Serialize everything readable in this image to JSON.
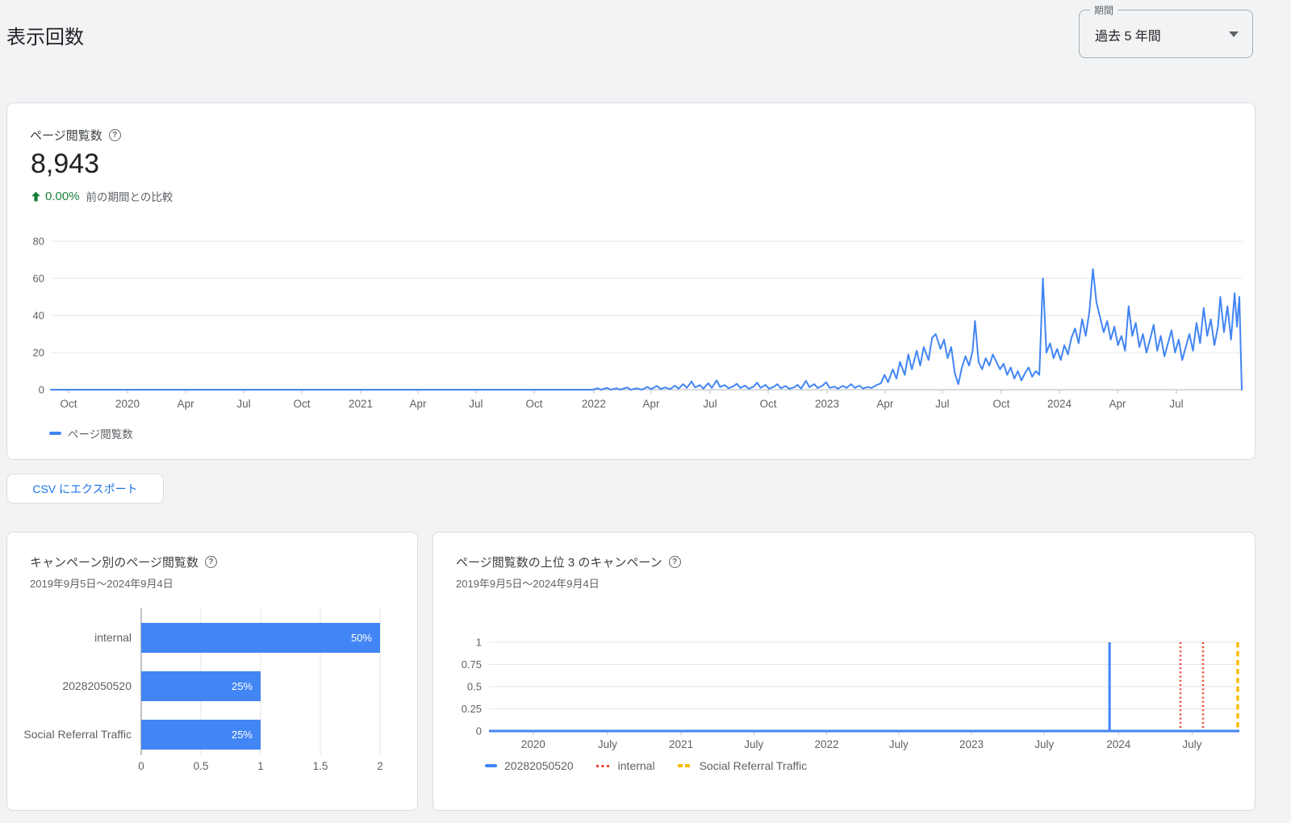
{
  "page": {
    "title": "表示回数"
  },
  "period_select": {
    "label": "期間",
    "value": "過去 5 年間"
  },
  "pageviews_card": {
    "title": "ページ閲覧数",
    "total": "8,943",
    "delta_percent": "0.00%",
    "delta_caption": "前の期間との比較",
    "legend_label": "ページ閲覧数"
  },
  "export_button": {
    "label": "CSV にエクスポート"
  },
  "campaign_bar_card": {
    "title": "キャンペーン別のページ閲覧数",
    "subtitle": "2019年9月5日〜2024年9月4日"
  },
  "top_campaigns_card": {
    "title": "ページ閲覧数の上位 3 のキャンペーン",
    "subtitle": "2019年9月5日〜2024年9月4日",
    "legend": [
      {
        "label": "20282050520",
        "color": "#4285f4",
        "style": "solid"
      },
      {
        "label": "internal",
        "color": "#ea4335",
        "style": "dotted"
      },
      {
        "label": "Social Referral Traffic",
        "color": "#fbbc04",
        "style": "dashed"
      }
    ]
  },
  "colors": {
    "accent_blue": "#4285f4",
    "link_blue": "#1a73e8",
    "positive_green": "#188038",
    "event_red": "#ea4335",
    "event_yellow": "#fbbc04",
    "grid": "#e6e6e6",
    "axis_text": "#616161",
    "background": "#f1f3f4"
  },
  "chart_data": [
    {
      "type": "line",
      "title": "ページ閲覧数",
      "ylim": [
        0,
        80
      ],
      "yticks": [
        0,
        20,
        40,
        60,
        80
      ],
      "ytick_labels": [
        "0",
        "20",
        "40",
        "60",
        "80"
      ],
      "xticks": {
        "labels": [
          "Oct",
          "2020",
          "Apr",
          "Jul",
          "Oct",
          "2021",
          "Apr",
          "Jul",
          "Oct",
          "2022",
          "Apr",
          "Jul",
          "Oct",
          "2023",
          "Apr",
          "Jul",
          "Oct",
          "2024",
          "Apr",
          "Jul"
        ],
        "fracs": [
          0.0149,
          0.0644,
          0.1132,
          0.1619,
          0.2107,
          0.2602,
          0.3083,
          0.357,
          0.4058,
          0.4559,
          0.5041,
          0.5535,
          0.6023,
          0.6518,
          0.7005,
          0.7486,
          0.798,
          0.8469,
          0.8957,
          0.9451
        ]
      },
      "series": [
        {
          "name": "ページ閲覧数",
          "color": "#4285f4",
          "points": [
            [
              0.0,
              0
            ],
            [
              0.05,
              0
            ],
            [
              0.1,
              0
            ],
            [
              0.15,
              0
            ],
            [
              0.2,
              0
            ],
            [
              0.25,
              0
            ],
            [
              0.3,
              0
            ],
            [
              0.35,
              0
            ],
            [
              0.4,
              0
            ],
            [
              0.44,
              0
            ],
            [
              0.455,
              0
            ],
            [
              0.459,
              0.8
            ],
            [
              0.462,
              0
            ],
            [
              0.467,
              1
            ],
            [
              0.47,
              0
            ],
            [
              0.475,
              0.8
            ],
            [
              0.478,
              0
            ],
            [
              0.484,
              1.2
            ],
            [
              0.487,
              0
            ],
            [
              0.492,
              0.8
            ],
            [
              0.496,
              0
            ],
            [
              0.501,
              1.5
            ],
            [
              0.504,
              0.3
            ],
            [
              0.509,
              2
            ],
            [
              0.512,
              0.4
            ],
            [
              0.516,
              1.2
            ],
            [
              0.52,
              0.3
            ],
            [
              0.524,
              2.2
            ],
            [
              0.527,
              0.6
            ],
            [
              0.531,
              3
            ],
            [
              0.534,
              1
            ],
            [
              0.538,
              4.5
            ],
            [
              0.541,
              1.2
            ],
            [
              0.545,
              2.5
            ],
            [
              0.548,
              0.6
            ],
            [
              0.552,
              3.5
            ],
            [
              0.555,
              1
            ],
            [
              0.559,
              5
            ],
            [
              0.562,
              1.5
            ],
            [
              0.566,
              2.5
            ],
            [
              0.569,
              0.8
            ],
            [
              0.573,
              1.8
            ],
            [
              0.576,
              3.2
            ],
            [
              0.579,
              0.9
            ],
            [
              0.583,
              2.2
            ],
            [
              0.586,
              0.5
            ],
            [
              0.59,
              1.6
            ],
            [
              0.593,
              3.8
            ],
            [
              0.596,
              1
            ],
            [
              0.6,
              2.6
            ],
            [
              0.603,
              0.6
            ],
            [
              0.607,
              1.5
            ],
            [
              0.61,
              3
            ],
            [
              0.613,
              0.8
            ],
            [
              0.617,
              2
            ],
            [
              0.62,
              0.5
            ],
            [
              0.624,
              1.2
            ],
            [
              0.627,
              2.6
            ],
            [
              0.63,
              0.6
            ],
            [
              0.634,
              4.8
            ],
            [
              0.637,
              1.4
            ],
            [
              0.641,
              3
            ],
            [
              0.644,
              0.9
            ],
            [
              0.648,
              2.2
            ],
            [
              0.651,
              4
            ],
            [
              0.654,
              1
            ],
            [
              0.658,
              1.6
            ],
            [
              0.661,
              0.5
            ],
            [
              0.665,
              2.1
            ],
            [
              0.668,
              0.9
            ],
            [
              0.672,
              3
            ],
            [
              0.675,
              1
            ],
            [
              0.679,
              2.2
            ],
            [
              0.682,
              0.6
            ],
            [
              0.686,
              1.5
            ],
            [
              0.689,
              0.9
            ],
            [
              0.693,
              2.4
            ],
            [
              0.697,
              3.5
            ],
            [
              0.7,
              8
            ],
            [
              0.703,
              4
            ],
            [
              0.707,
              11
            ],
            [
              0.71,
              6
            ],
            [
              0.713,
              15
            ],
            [
              0.717,
              8
            ],
            [
              0.72,
              19
            ],
            [
              0.723,
              11
            ],
            [
              0.727,
              21
            ],
            [
              0.73,
              13
            ],
            [
              0.733,
              23
            ],
            [
              0.737,
              16
            ],
            [
              0.74,
              28
            ],
            [
              0.743,
              30
            ],
            [
              0.747,
              22
            ],
            [
              0.75,
              27
            ],
            [
              0.753,
              17
            ],
            [
              0.756,
              23
            ],
            [
              0.759,
              9
            ],
            [
              0.762,
              3
            ],
            [
              0.765,
              12
            ],
            [
              0.768,
              18
            ],
            [
              0.771,
              13
            ],
            [
              0.774,
              21
            ],
            [
              0.776,
              37
            ],
            [
              0.779,
              15
            ],
            [
              0.782,
              11
            ],
            [
              0.785,
              17
            ],
            [
              0.788,
              13
            ],
            [
              0.791,
              19
            ],
            [
              0.794,
              15
            ],
            [
              0.797,
              11
            ],
            [
              0.8,
              14
            ],
            [
              0.803,
              8
            ],
            [
              0.806,
              12
            ],
            [
              0.809,
              6
            ],
            [
              0.812,
              10
            ],
            [
              0.815,
              5
            ],
            [
              0.818,
              9
            ],
            [
              0.821,
              12
            ],
            [
              0.824,
              7
            ],
            [
              0.827,
              10
            ],
            [
              0.83,
              8
            ],
            [
              0.833,
              60
            ],
            [
              0.836,
              20
            ],
            [
              0.839,
              25
            ],
            [
              0.842,
              17
            ],
            [
              0.845,
              22
            ],
            [
              0.848,
              16
            ],
            [
              0.851,
              24
            ],
            [
              0.854,
              19
            ],
            [
              0.857,
              28
            ],
            [
              0.86,
              33
            ],
            [
              0.863,
              25
            ],
            [
              0.866,
              38
            ],
            [
              0.869,
              29
            ],
            [
              0.872,
              42
            ],
            [
              0.875,
              65
            ],
            [
              0.878,
              47
            ],
            [
              0.881,
              39
            ],
            [
              0.884,
              31
            ],
            [
              0.887,
              37
            ],
            [
              0.89,
              27
            ],
            [
              0.893,
              34
            ],
            [
              0.896,
              24
            ],
            [
              0.899,
              29
            ],
            [
              0.902,
              21
            ],
            [
              0.905,
              45
            ],
            [
              0.908,
              29
            ],
            [
              0.911,
              36
            ],
            [
              0.914,
              23
            ],
            [
              0.917,
              30
            ],
            [
              0.92,
              20
            ],
            [
              0.923,
              27
            ],
            [
              0.926,
              35
            ],
            [
              0.929,
              21
            ],
            [
              0.932,
              29
            ],
            [
              0.935,
              18
            ],
            [
              0.938,
              25
            ],
            [
              0.941,
              32
            ],
            [
              0.944,
              20
            ],
            [
              0.947,
              27
            ],
            [
              0.95,
              16
            ],
            [
              0.953,
              23
            ],
            [
              0.956,
              30
            ],
            [
              0.959,
              21
            ],
            [
              0.962,
              36
            ],
            [
              0.965,
              25
            ],
            [
              0.968,
              44
            ],
            [
              0.971,
              29
            ],
            [
              0.974,
              38
            ],
            [
              0.977,
              24
            ],
            [
              0.98,
              34
            ],
            [
              0.982,
              50
            ],
            [
              0.985,
              31
            ],
            [
              0.988,
              45
            ],
            [
              0.991,
              27
            ],
            [
              0.994,
              52
            ],
            [
              0.996,
              34
            ],
            [
              0.998,
              50
            ],
            [
              1.0,
              0
            ]
          ]
        }
      ]
    },
    {
      "type": "bar",
      "orientation": "horizontal",
      "title": "キャンペーン別のページ閲覧数",
      "categories": [
        "internal",
        "20282050520",
        "Social Referral Traffic"
      ],
      "values": [
        2,
        1,
        1
      ],
      "bar_labels": [
        "50%",
        "25%",
        "25%"
      ],
      "xlim": [
        0,
        2
      ],
      "xticks": [
        0,
        0.5,
        1,
        1.5,
        2
      ],
      "xtick_labels": [
        "0",
        "0.5",
        "1",
        "1.5",
        "2"
      ],
      "bar_color": "#4285f4"
    },
    {
      "type": "line",
      "title": "ページ閲覧数の上位 3 のキャンペーン",
      "ylim": [
        0,
        1
      ],
      "yticks": [
        0,
        0.25,
        0.5,
        0.75,
        1
      ],
      "ytick_labels": [
        "0",
        "0.25",
        "0.5",
        "0.75",
        "1"
      ],
      "xticks": {
        "labels": [
          "2020",
          "July",
          "2021",
          "July",
          "2022",
          "July",
          "2023",
          "July",
          "2024",
          "July"
        ],
        "fracs": [
          0.059,
          0.158,
          0.256,
          0.353,
          0.45,
          0.546,
          0.643,
          0.74,
          0.839,
          0.937
        ]
      },
      "series": [
        {
          "name": "20282050520",
          "color": "#4285f4",
          "style": "solid",
          "baseline": 0,
          "spikes": [
            {
              "frac": 0.827,
              "value": 1
            }
          ]
        },
        {
          "name": "internal",
          "color": "#ea4335",
          "style": "dotted",
          "spikes": [
            {
              "frac": 0.9215,
              "value": 1
            },
            {
              "frac": 0.9516,
              "value": 1
            }
          ]
        },
        {
          "name": "Social Referral Traffic",
          "color": "#fbbc04",
          "style": "dashed",
          "spikes": [
            {
              "frac": 0.9978,
              "value": 1
            }
          ]
        }
      ]
    }
  ]
}
